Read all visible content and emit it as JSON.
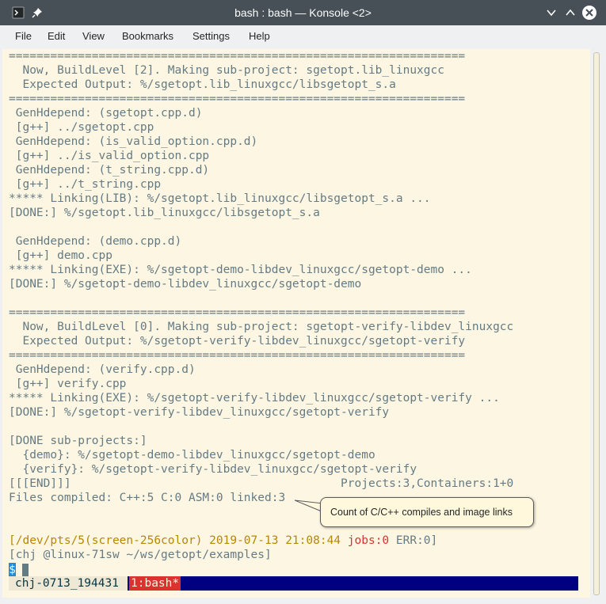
{
  "window": {
    "title": "bash : bash — Konsole <2>",
    "app_icon": "terminal-icon",
    "pin_icon": "pin-icon",
    "controls": [
      "minimize-icon",
      "maximize-icon",
      "close-icon"
    ]
  },
  "menubar": [
    "File",
    "Edit",
    "View",
    "Bookmarks",
    "Settings",
    "Help"
  ],
  "terminal": {
    "lines": [
      "==================================================================",
      "  Now, BuildLevel [2]. Making sub-project: sgetopt.lib_linuxgcc",
      "  Expected Output: %/sgetopt.lib_linuxgcc/libsgetopt_s.a",
      "==================================================================",
      " GenHdepend: (sgetopt.cpp.d)",
      " [g++] ../sgetopt.cpp",
      " GenHdepend: (is_valid_option.cpp.d)",
      " [g++] ../is_valid_option.cpp",
      " GenHdepend: (t_string.cpp.d)",
      " [g++] ../t_string.cpp",
      "***** Linking(LIB): %/sgetopt.lib_linuxgcc/libsgetopt_s.a ...",
      "[DONE:] %/sgetopt.lib_linuxgcc/libsgetopt_s.a",
      "",
      " GenHdepend: (demo.cpp.d)",
      " [g++] demo.cpp",
      "***** Linking(EXE): %/sgetopt-demo-libdev_linuxgcc/sgetopt-demo ...",
      "[DONE:] %/sgetopt-demo-libdev_linuxgcc/sgetopt-demo",
      "",
      "==================================================================",
      "  Now, BuildLevel [0]. Making sub-project: sgetopt-verify-libdev_linuxgcc",
      "  Expected Output: %/sgetopt-verify-libdev_linuxgcc/sgetopt-verify",
      "==================================================================",
      " GenHdepend: (verify.cpp.d)",
      " [g++] verify.cpp",
      "***** Linking(EXE): %/sgetopt-verify-libdev_linuxgcc/sgetopt-verify ...",
      "[DONE:] %/sgetopt-verify-libdev_linuxgcc/sgetopt-verify",
      "",
      "[DONE sub-projects:]",
      "  {demo}: %/sgetopt-demo-libdev_linuxgcc/sgetopt-demo",
      "  {verify}: %/sgetopt-verify-libdev_linuxgcc/sgetopt-verify",
      "[[[END]]]                                       Projects:3,Containers:1+0",
      "Files compiled: C++:5 C:0 ASM:0 linked:3"
    ],
    "prompt": {
      "path_part": "[/dev/pts/5(screen-256color) 2019-07-13 21:08:44 ",
      "jobs_part": "jobs:0",
      "err_part": " ERR:0]",
      "user_line": "[chj @linux-71sw ~/ws/getopt/examples]",
      "dollar": "$"
    },
    "screen_bar": {
      "session": "chj-0713_194431",
      "window": "1:bash*"
    }
  },
  "callout": {
    "text": "Count of C/C++ compiles and image links"
  },
  "colors": {
    "titlebar": "#475057",
    "terminal_bg": "#fdf6e3",
    "terminal_fg": "#657b83",
    "prompt_yellow": "#b58900",
    "prompt_red": "#dc322f",
    "screen_bar_bg": "#000080",
    "callout_bg": "#fff8dc"
  }
}
